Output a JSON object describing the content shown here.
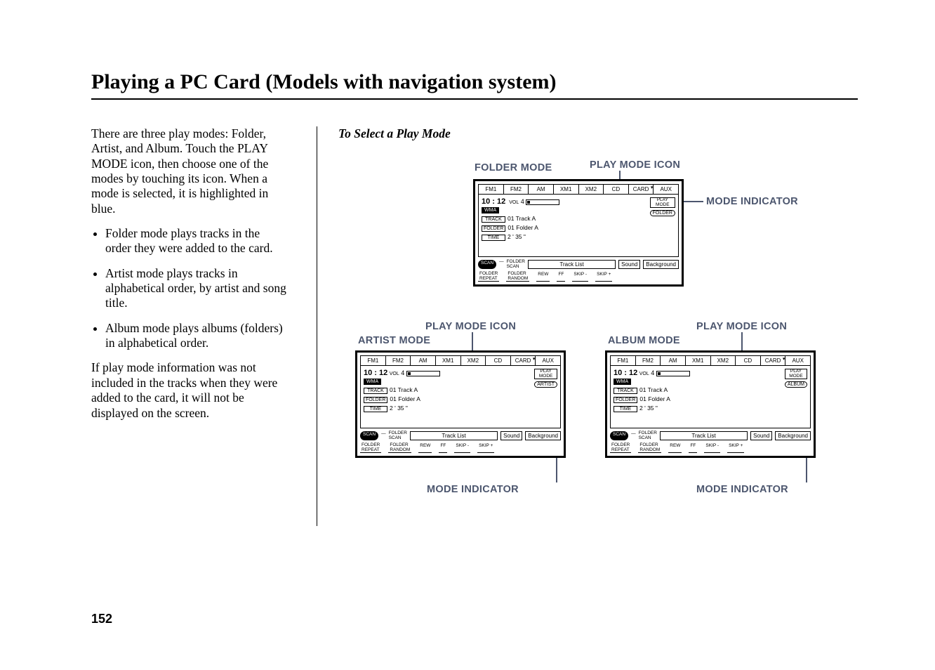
{
  "page": {
    "title": "Playing a PC Card (Models with navigation system)",
    "number": "152"
  },
  "body": {
    "intro": "There are three play modes: Folder, Artist, and Album. Touch the PLAY MODE icon, then choose one of the modes by touching its icon. When a mode is selected, it is highlighted in blue.",
    "bullets": [
      "Folder mode plays tracks in the order they were added to the card.",
      "Artist mode plays tracks in alphabetical order, by artist and song title.",
      "Album mode plays albums (folders) in alphabetical order."
    ],
    "note": "If play mode information was not included in the tracks when they were added to the card, it will not be displayed on the screen."
  },
  "right": {
    "subhead": "To Select a Play Mode",
    "labels": {
      "folder_mode": "FOLDER MODE",
      "artist_mode": "ARTIST MODE",
      "album_mode": "ALBUM MODE",
      "play_mode_icon": "PLAY MODE ICON",
      "mode_indicator": "MODE INDICATOR"
    }
  },
  "screen": {
    "tabs": [
      "FM1",
      "FM2",
      "AM",
      "XM1",
      "XM2",
      "CD",
      "CARD",
      "AUX"
    ],
    "time": "10 : 12",
    "vol_label": "VOL",
    "vol_value": "4",
    "codec": "WMA",
    "track_label": "TRACK",
    "track_value": "01  Track  A",
    "folder_label": "FOLDER",
    "folder_value": "01  Folder  A",
    "time_label": "TIME",
    "time_value": "2 ' 35 \"",
    "playmode_label": "PLAY\nMODE",
    "mode_folder": "FOLDER",
    "mode_artist": "ARTIST",
    "mode_album": "ALBUM",
    "scan": "SCAN",
    "folder_scan": "FOLDER\nSCAN",
    "track_list": "Track  List",
    "sound": "Sound",
    "background": "Background",
    "bottom": [
      "FOLDER\nREPEAT",
      "FOLDER\nRANDOM",
      "REW",
      "FF",
      "SKIP -",
      "SKIP +"
    ]
  }
}
